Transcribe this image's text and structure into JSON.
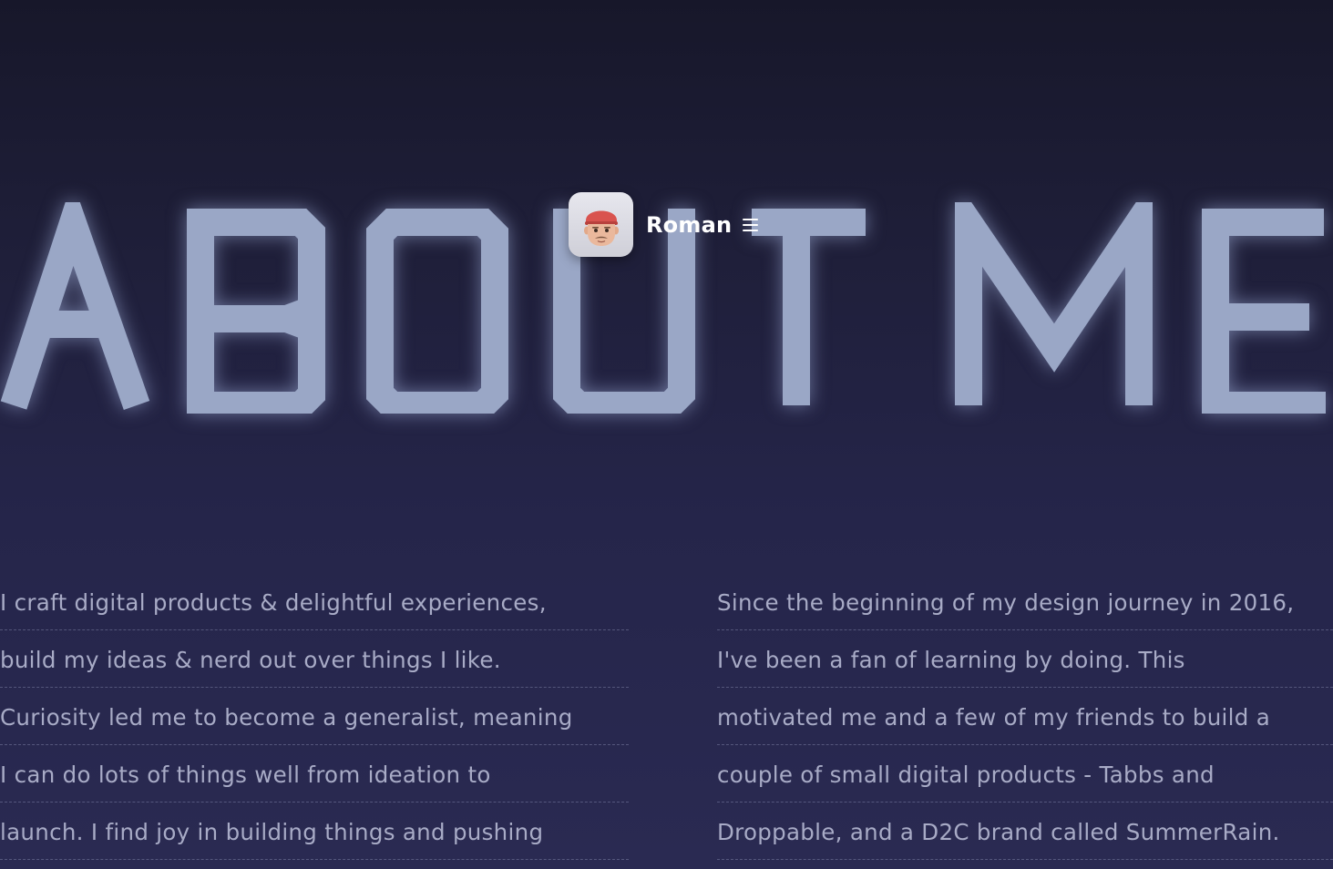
{
  "hero": {
    "heading": "ABOUT ME"
  },
  "nav": {
    "brand": "Roman",
    "avatar_icon": "memoji-avatar-icon",
    "menu_icon": "hamburger-menu-icon"
  },
  "about": {
    "left_lines": [
      "I craft digital products & delightful experiences,",
      "build my ideas & nerd out over things I like.",
      "Curiosity led me to become a generalist, meaning",
      "I can do lots of things well from ideation to",
      "launch. I find joy in building things and pushing"
    ],
    "right_lines": [
      "Since the beginning of my design journey in 2016,",
      "I've been a fan of learning by doing. This",
      "motivated me and a few of my friends to build a",
      "couple of small digital products - Tabbs and",
      "Droppable, and a D2C brand called SummerRain."
    ]
  },
  "colors": {
    "background_top": "#17172a",
    "background_bottom": "#2a2a52",
    "heading": "#9aa7c6",
    "body_text": "#a8abc6",
    "brand_text": "#ffffff"
  }
}
